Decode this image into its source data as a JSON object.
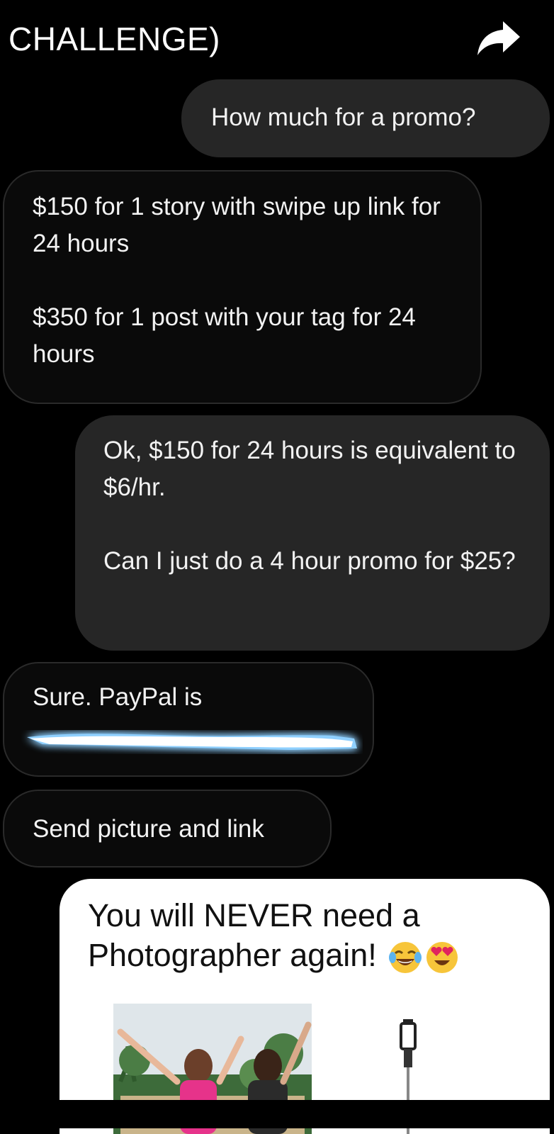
{
  "header": {
    "title": "CHALLENGE)",
    "share_icon": "share-arrow-icon"
  },
  "messages": [
    {
      "direction": "outgoing",
      "paragraphs": [
        "How much for a promo?"
      ]
    },
    {
      "direction": "incoming",
      "paragraphs": [
        "$150 for 1 story with swipe up link for 24 hours",
        "$350 for 1 post with your tag for 24 hours"
      ]
    },
    {
      "direction": "outgoing",
      "paragraphs": [
        "Ok, $150 for 24 hours is equivalent to $6/hr.",
        "Can I just do a 4 hour promo for $25?"
      ]
    },
    {
      "direction": "incoming",
      "paragraphs": [
        "Sure. PayPal is"
      ],
      "redacted": true
    },
    {
      "direction": "incoming",
      "paragraphs": [
        "Send picture and link"
      ]
    }
  ],
  "ad": {
    "headline": "You will NEVER need a Photographer again!",
    "emojis": [
      "face-with-tears-of-joy-icon",
      "heart-eyes-icon"
    ]
  },
  "colors": {
    "background": "#000000",
    "outgoing_bubble": "#262626",
    "incoming_border": "#2a2a2a",
    "redaction_glow": "#5fb4ff"
  }
}
